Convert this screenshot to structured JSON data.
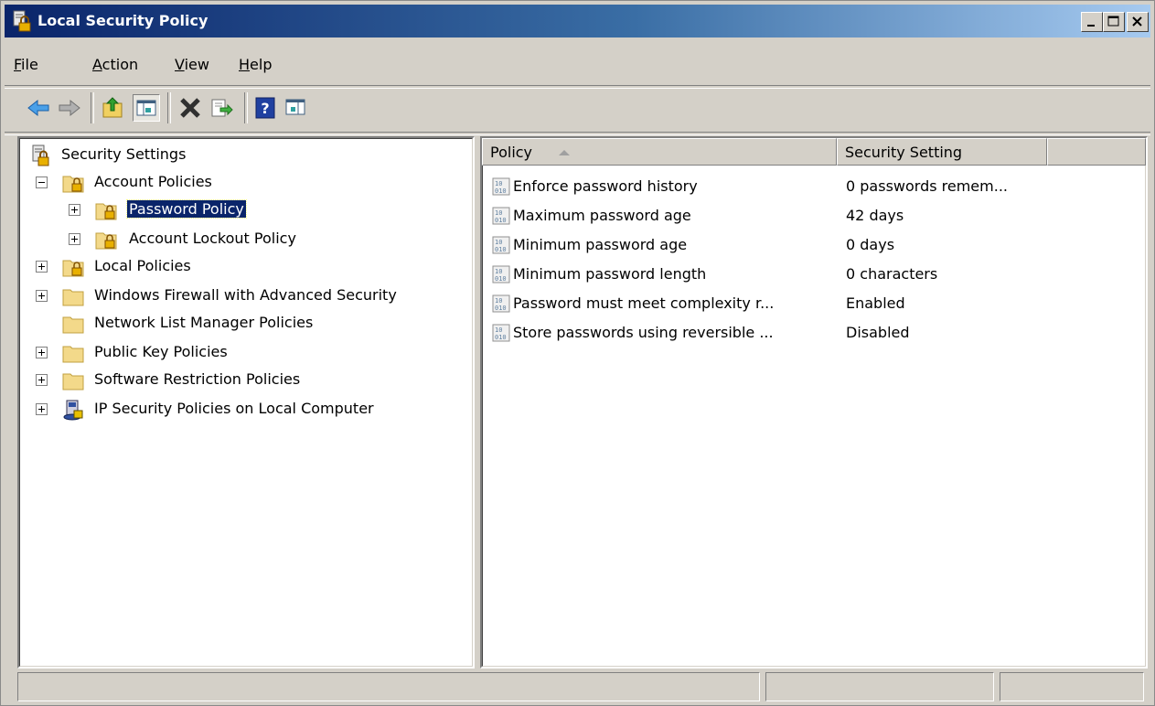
{
  "window": {
    "title": "Local Security Policy",
    "colors": {
      "titlebar_start": "#0a246a",
      "titlebar_end": "#a6caf0",
      "selection": "#0a246a",
      "face": "#d4d0c8"
    }
  },
  "menu": {
    "file": {
      "accel": "F",
      "rest": "ile"
    },
    "action": {
      "accel": "A",
      "rest": "ction"
    },
    "view": {
      "accel": "V",
      "rest": "iew"
    },
    "help": {
      "accel": "H",
      "rest": "elp"
    }
  },
  "toolbar": {
    "icons": [
      "back-arrow-icon",
      "forward-arrow-icon",
      "up-folder-icon",
      "show-hide-console-tree-icon",
      "delete-x-icon",
      "export-list-icon",
      "help-icon",
      "show-action-pane-icon"
    ]
  },
  "tree": {
    "root": "Security Settings",
    "items": [
      {
        "label": "Account Policies"
      },
      {
        "label": "Password Policy"
      },
      {
        "label": "Account Lockout Policy"
      },
      {
        "label": "Local Policies"
      },
      {
        "label": "Windows Firewall with Advanced Security"
      },
      {
        "label": "Network List Manager Policies"
      },
      {
        "label": "Public Key Policies"
      },
      {
        "label": "Software Restriction Policies"
      },
      {
        "label": "IP Security Policies on Local Computer"
      }
    ]
  },
  "list": {
    "columns": {
      "policy": "Policy",
      "setting": "Security Setting"
    },
    "rows": [
      {
        "policy": "Enforce password history",
        "setting": "0 passwords remem..."
      },
      {
        "policy": "Maximum password age",
        "setting": "42 days"
      },
      {
        "policy": "Minimum password age",
        "setting": "0 days"
      },
      {
        "policy": "Minimum password length",
        "setting": "0 characters"
      },
      {
        "policy": "Password must meet complexity r...",
        "setting": "Enabled"
      },
      {
        "policy": "Store passwords using reversible ...",
        "setting": "Disabled"
      }
    ]
  }
}
